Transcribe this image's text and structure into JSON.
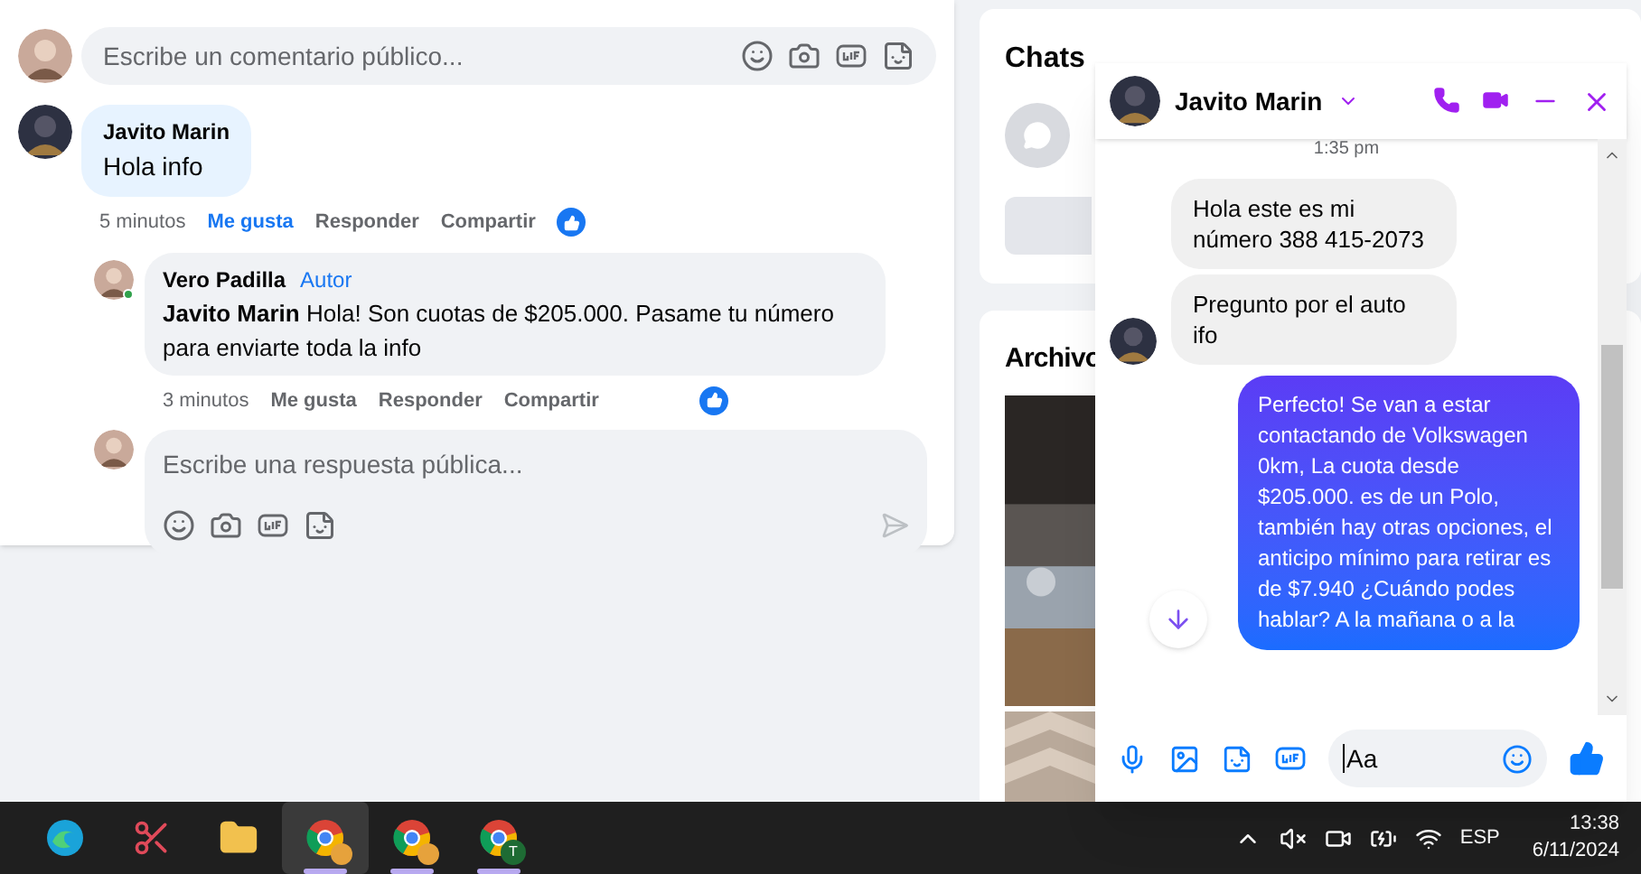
{
  "comment_box": {
    "placeholder": "Escribe un comentario público..."
  },
  "comments": [
    {
      "author": "Javito Marin",
      "text": "Hola info",
      "time": "5 minutos",
      "like": "Me gusta",
      "liked": true,
      "reply": "Responder",
      "share": "Compartir",
      "replies": [
        {
          "author": "Vero Padilla",
          "badge": "Autor",
          "online": true,
          "mention": "Javito Marin",
          "text": "Hola! Son cuotas de $205.000. Pasame tu número para enviarte toda la info",
          "time": "3 minutos",
          "like": "Me gusta",
          "liked": false,
          "reply": "Responder",
          "share": "Compartir"
        }
      ]
    }
  ],
  "reply_box": {
    "placeholder": "Escribe una respuesta pública..."
  },
  "chats_card": {
    "title": "Chats"
  },
  "files_card": {
    "title": "Archivo"
  },
  "chat": {
    "name": "Javito Marin",
    "timestamp": "1:35 pm",
    "messages": [
      {
        "kind": "received",
        "text": "Hola este es mi número 388 415-2073"
      },
      {
        "kind": "received",
        "text": "Pregunto por el auto ifo"
      },
      {
        "kind": "sent",
        "text": "Perfecto!  Se van a estar contactando de Volkswagen 0km, La cuota desde $205.000. es de un Polo, también hay otras opciones, el anticipo mínimo para retirar es de $7.940 ¿Cuándo podes hablar? A la mañana o a la"
      }
    ],
    "input": {
      "value": "Aa"
    }
  },
  "taskbar": {
    "apps": [
      {
        "kind": "edge",
        "selected": false,
        "running": false
      },
      {
        "kind": "snip",
        "selected": false,
        "running": false
      },
      {
        "kind": "folder",
        "selected": false,
        "running": false
      },
      {
        "kind": "chrome",
        "selected": true,
        "running": true
      },
      {
        "kind": "chrome",
        "selected": false,
        "running": true
      },
      {
        "kind": "chrome",
        "selected": false,
        "running": true,
        "badge": "T"
      }
    ],
    "language": "ESP",
    "time": "13:38",
    "date": "6/11/2024"
  }
}
